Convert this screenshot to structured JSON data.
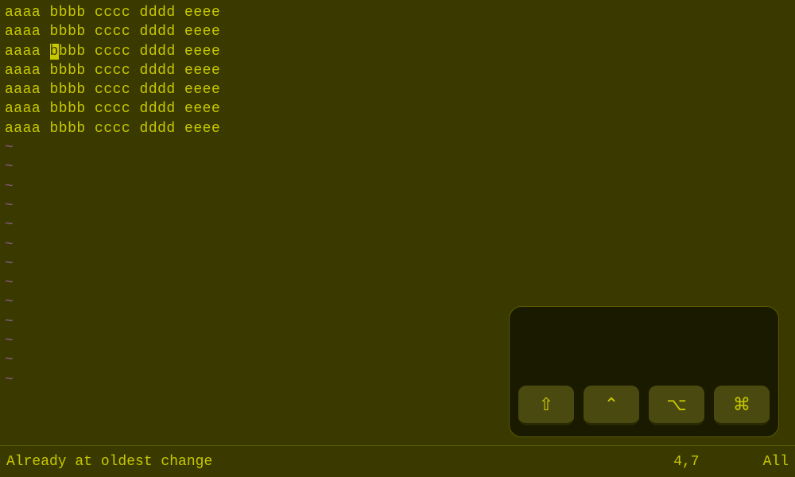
{
  "editor": {
    "lines": [
      "aaaa bbbb cccc dddd eeee",
      "aaaa bbbb cccc dddd eeee",
      "aaaa bbbb cccc dddd eeee",
      "aaaa bbbb cccc dddd eeee",
      "aaaa bbbb cccc dddd eeee",
      "aaaa bbbb cccc dddd eeee",
      "aaaa bbbb cccc dddd eeee"
    ],
    "tilde_count": 13
  },
  "status": {
    "message": "Already at oldest change",
    "cursor_pos": "4,7",
    "scroll": "All"
  },
  "keyboard": {
    "buttons": [
      {
        "label": "⇧",
        "name": "shift"
      },
      {
        "label": "⌃",
        "name": "ctrl"
      },
      {
        "label": "⌥",
        "name": "alt"
      },
      {
        "label": "⌘",
        "name": "cmd"
      }
    ]
  }
}
